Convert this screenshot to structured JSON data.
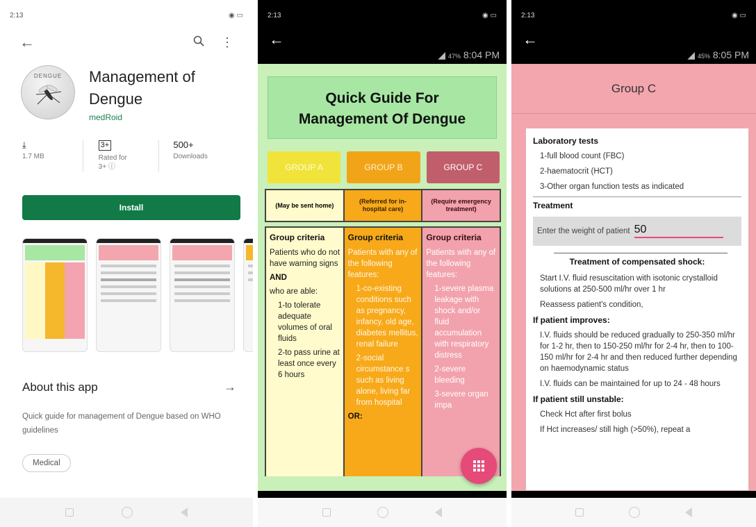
{
  "p1": {
    "status_time": "2:13",
    "app_name_line1": "Management of",
    "app_name_line2": "Dengue",
    "logo_text": "DENGUE",
    "developer": "medRoid",
    "size": "1.7 MB",
    "rating_badge": "3+",
    "rated_label": "Rated for",
    "rated_value": "3+ ⓘ",
    "downloads_value": "500+",
    "downloads_label": "Downloads",
    "install_label": "Install",
    "about_title": "About this app",
    "description": "Quick guide for management of Dengue based on WHO guidelines",
    "chip": "Medical"
  },
  "p2": {
    "status_time": "2:13",
    "clock": "8:04 PM",
    "battery": "47%",
    "title_line1": "Quick Guide For",
    "title_line2": "Management Of Dengue",
    "group_a": "GROUP A",
    "group_b": "GROUP B",
    "group_c": "GROUP C",
    "head_a": "(May be sent home)",
    "head_b": "(Referred for in-hospital care)",
    "head_c": "(Require emergency treatment)",
    "col_a": {
      "title": "Group criteria",
      "p1": "Patients who do not have warning signs",
      "and": "AND",
      "p2": "who are able:",
      "i1": "1-to tolerate adequate volumes of oral fluids",
      "i2": "2-to pass urine at least once every 6 hours"
    },
    "col_b": {
      "title": "Group criteria",
      "p1": "Patients with any of the following features:",
      "i1": "1-co-existing conditions such as pregnancy, infancy, old age, diabetes mellitus, renal failure",
      "i2": "2-social circumstance s such as living alone, living far from hospital",
      "or": "OR:"
    },
    "col_c": {
      "title": "Group criteria",
      "p1": "Patients with any of the following features:",
      "i1": "1-severe plasma leakage with shock and/or fluid accumulation with respiratory distress",
      "i2": "2-severe bleeding",
      "i3": "3-severe organ impa"
    }
  },
  "p3": {
    "status_time": "2:13",
    "clock": "8:05 PM",
    "battery": "45%",
    "header": "Group C",
    "lab_title": "Laboratory tests",
    "lab1": "1-full blood count (FBC)",
    "lab2": "2-haematocrit (HCT)",
    "lab3": "3-Other organ function tests as indicated",
    "treatment_title": "Treatment",
    "weight_label": "Enter the weight of patient",
    "weight_value": "50",
    "shock_title": "Treatment of compensated shock:",
    "t1": "Start I.V. fluid resuscitation with isotonic crystalloid solutions at 250-500 ml/hr over 1 hr",
    "t2": "Reassess patient's condition,",
    "improves_title": "If patient improves:",
    "t3": "I.V. fluids should be reduced gradually to 250-350 ml/hr for 1-2 hr, then to 150-250 ml/hr for 2-4 hr, then to 100-150 ml/hr for 2-4 hr and then reduced further depending on haemodynamic status",
    "t4": "I.V. fluids can be maintained for up to 24 - 48 hours",
    "unstable_title": "If patient still unstable:",
    "t5": "Check Hct after first bolus",
    "t6": "If Hct increases/ still high (>50%), repeat a"
  }
}
